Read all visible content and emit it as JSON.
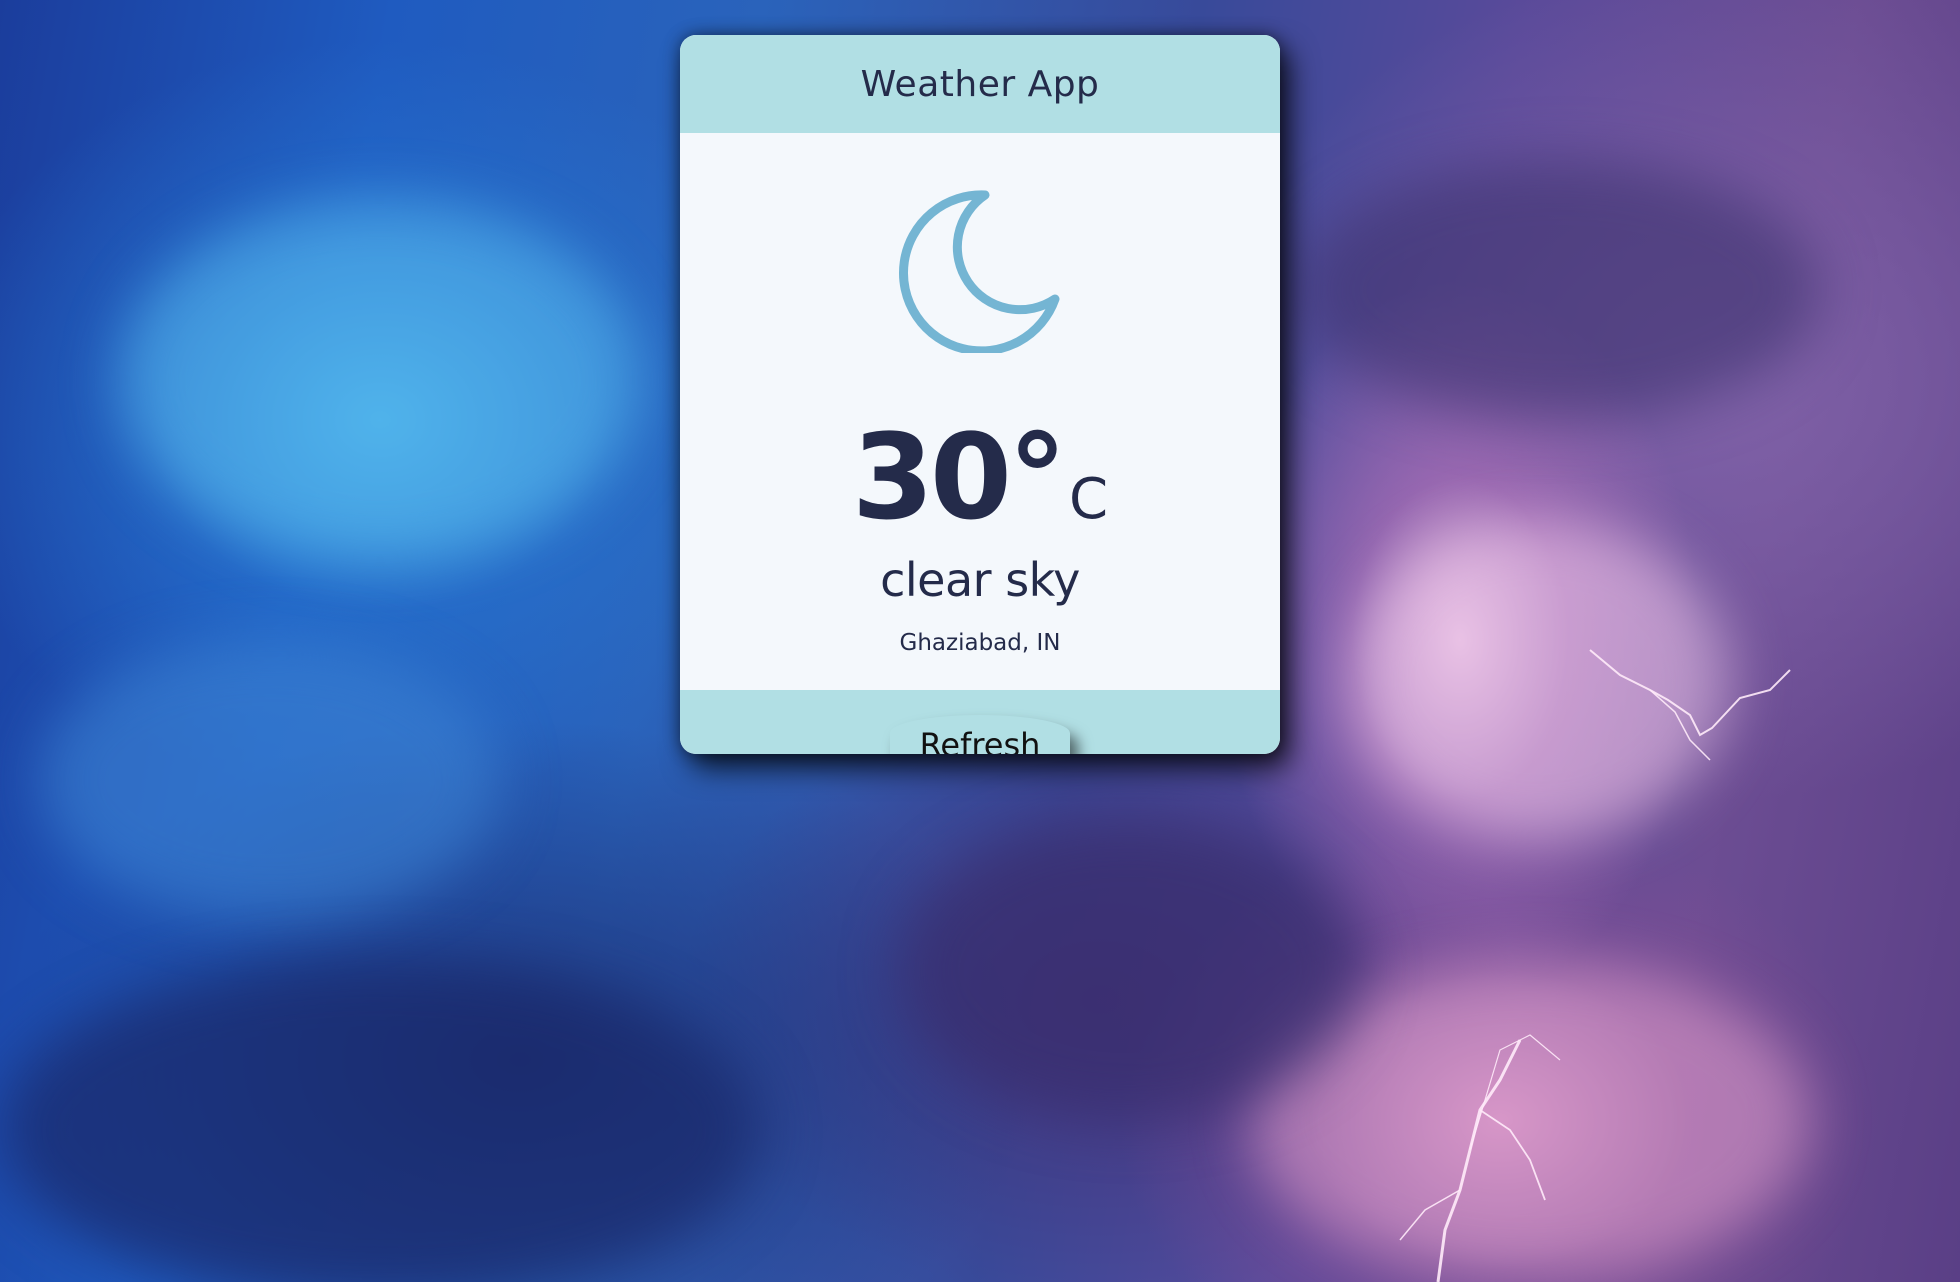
{
  "app": {
    "title": "Weather App"
  },
  "weather": {
    "icon": "moon-icon",
    "temperature": "30°",
    "unit": "C",
    "condition": "clear sky",
    "location": "Ghaziabad, IN"
  },
  "actions": {
    "refresh_label": "Refresh"
  },
  "colors": {
    "panel_accent": "#b1dfe4",
    "card_background": "#f4f8fc",
    "text_primary": "#242b4a",
    "icon_stroke": "#74b5d3"
  },
  "background": {
    "scene": "stormy-sky-with-lightning"
  }
}
